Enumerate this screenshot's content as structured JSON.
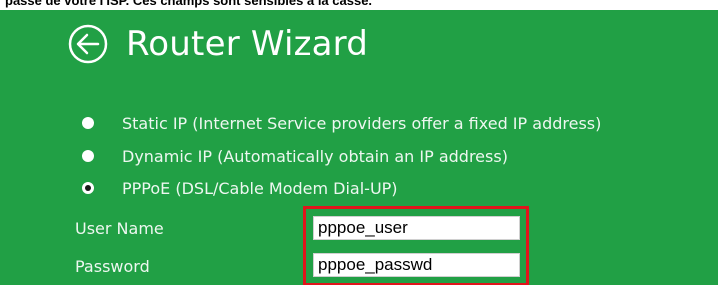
{
  "top_text": "passe de votre I'ISP. Ces champs sont sensibles à la casse.",
  "window": {
    "title": "Router Wizard",
    "back_icon": "arrow-left-circle-icon"
  },
  "connection_options": [
    {
      "label": "Static IP (Internet Service providers offer a fixed IP address)",
      "selected": false
    },
    {
      "label": "Dynamic IP (Automatically obtain an IP address)",
      "selected": false
    },
    {
      "label": "PPPoE (DSL/Cable Modem Dial-UP)",
      "selected": true
    }
  ],
  "credentials": {
    "username_label": "User Name",
    "username_value": "pppoe_user",
    "password_label": "Password",
    "password_value": "pppoe_passwd"
  },
  "colors": {
    "panel_background": "#21a045",
    "highlight_border": "#e0151b",
    "text": "#ffffff"
  }
}
